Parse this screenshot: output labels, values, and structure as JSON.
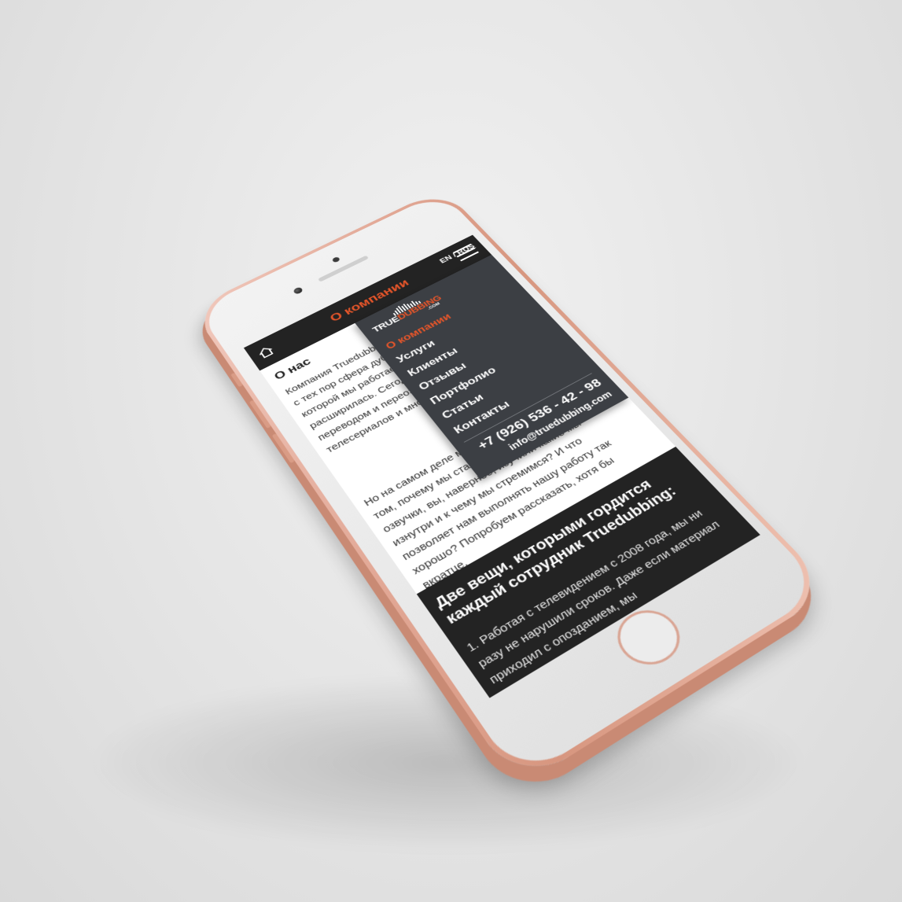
{
  "header": {
    "title": "О компании",
    "lang_en": "EN",
    "lang_sep": " / ",
    "lang_ru": "RUS"
  },
  "logo": {
    "word_main": "TRUE",
    "word_accent": "DUBBING",
    "suffix": ".COM"
  },
  "menu": {
    "items": [
      {
        "label": "О компании",
        "active": true
      },
      {
        "label": "Услуги",
        "active": false
      },
      {
        "label": "Клиенты",
        "active": false
      },
      {
        "label": "Отзывы",
        "active": false
      },
      {
        "label": "Портфолио",
        "active": false
      },
      {
        "label": "Статьи",
        "active": false
      },
      {
        "label": "Контакты",
        "active": false
      }
    ],
    "phone": "+7 (926) 536 - 42 - 98",
    "email": "info@truedubbing.com"
  },
  "content": {
    "heading": "О нас",
    "paragraph1": "Компания Truedubbing основана в 2003м году. И с тех пор сфера дубляжа и переозвучания, в которой мы работаем, быстро сфера расширилась. Сегодня мы занимаемся переводом и переозвучанием фильмов и телесериалов и многим другим.",
    "paragraph2": "Но на самом деле мы хотели бы поговорить о том, почему мы стали экспертами в сфере озвучки, вы, наверное, изучили какие мы изнутри и к чему мы стремимся? И что позволяет нам выполнять нашу работу так хорошо? Попробуем рассказать, хотя бы вкратце."
  },
  "band": {
    "title": "Две вещи, которыми гордится каждый сотрудник Truedubbing:",
    "text": "1. Работая с телевидением с 2008 года, мы ни разу не нарушили сроков. Даже если материал приходил с опозданием, мы"
  },
  "colors": {
    "accent": "#e8562a",
    "dark": "#232323",
    "menu_bg": "#3c3f44"
  },
  "icons": {
    "home": "home-icon",
    "menu": "hamburger-icon"
  }
}
